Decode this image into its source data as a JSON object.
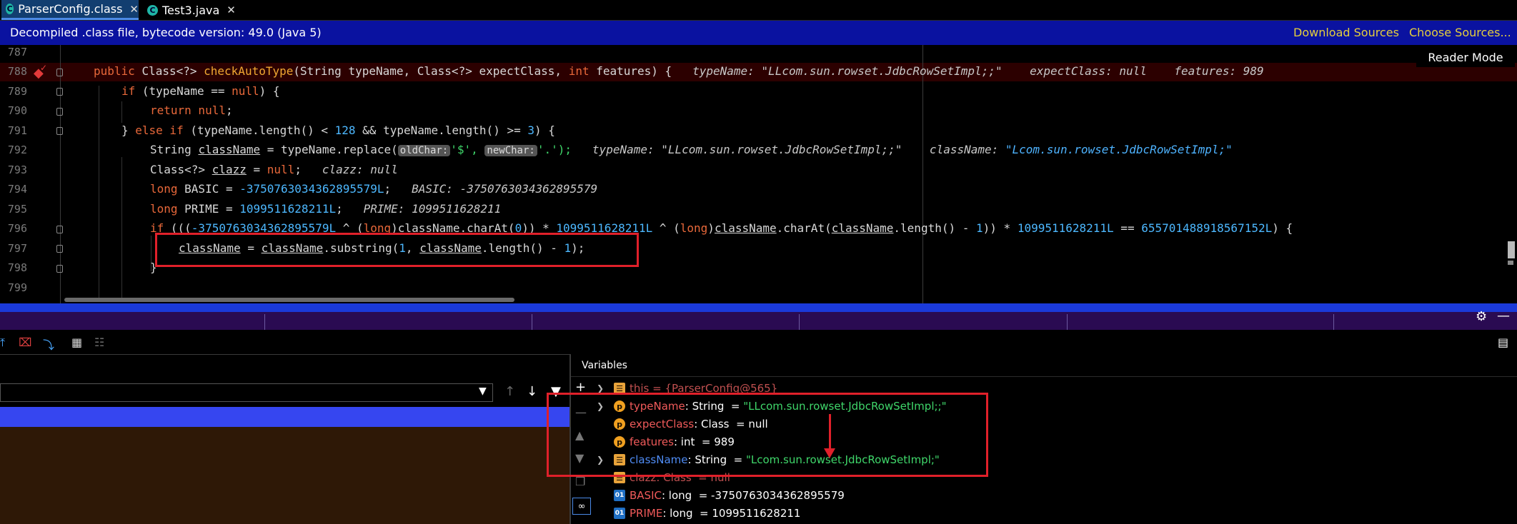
{
  "tabs": [
    {
      "label": "ParserConfig.class",
      "icon": "class-file-icon",
      "active": true
    },
    {
      "label": "Test3.java",
      "icon": "java-file-icon",
      "active": false
    }
  ],
  "banner": {
    "text": "Decompiled .class file, bytecode version: 49.0 (Java 5)",
    "download_sources": "Download Sources",
    "choose_sources": "Choose Sources..."
  },
  "editor": {
    "reader_mode": "Reader Mode",
    "line_numbers": [
      "787",
      "788",
      "789",
      "790",
      "791",
      "792",
      "793",
      "794",
      "795",
      "796",
      "797",
      "798",
      "799"
    ],
    "code": {
      "l788_public": "public",
      "l788_type": "Class<?>",
      "l788_method": "checkAutoType",
      "l788_open": "(String typeName, Class<?> expectClass, ",
      "l788_int": "int",
      "l788_rest": " features) {",
      "l788_hint": "typeName: \"LLcom.sun.rowset.JdbcRowSetImpl;;\"    expectClass: null    features: 989",
      "l789_if": "if",
      "l789_rest": " (typeName == ",
      "l789_null": "null",
      "l789_end": ") {",
      "l790_return": "return",
      "l790_null": " null",
      "l790_end": ";",
      "l791_a": "} ",
      "l791_else": "else if",
      "l791_b": " (typeName.length() < ",
      "l791_n1": "128",
      "l791_c": " && typeName.length() >= ",
      "l791_n2": "3",
      "l791_d": ") {",
      "l792_a": "String ",
      "l792_var": "className",
      "l792_b": " = typeName.replace(",
      "l792_chip1": "oldChar:",
      "l792_c": "'$', ",
      "l792_chip2": "newChar:",
      "l792_d": "'.');",
      "l792_hint": "typeName: \"LLcom.sun.rowset.JdbcRowSetImpl;;\"    className: ",
      "l792_hint_val": "\"Lcom.sun.rowset.JdbcRowSetImpl;\"",
      "l793_a": "Class<?> ",
      "l793_var": "clazz",
      "l793_b": " = ",
      "l793_null": "null",
      "l793_c": ";",
      "l793_hint": "clazz: null",
      "l794_long": "long",
      "l794_a": " BASIC = ",
      "l794_num": "-3750763034362895579L",
      "l794_b": ";",
      "l794_hint": "BASIC: -3750763034362895579",
      "l795_long": "long",
      "l795_a": " PRIME = ",
      "l795_num": "1099511628211L",
      "l795_b": ";",
      "l795_hint": "PRIME: 1099511628211",
      "l796_if": "if",
      "l796_a": " (((",
      "l796_n1": "-3750763034362895579L",
      "l796_b": " ^ (",
      "l796_long1": "long",
      "l796_c": ")",
      "l796_var1": "className",
      "l796_d": ".charAt(",
      "l796_n2": "0",
      "l796_e": ")) * ",
      "l796_n3": "1099511628211L",
      "l796_f": " ^ (",
      "l796_long2": "long",
      "l796_g": ")",
      "l796_var2": "className",
      "l796_h": ".charAt(",
      "l796_var3": "className",
      "l796_i": ".length() - ",
      "l796_n4": "1",
      "l796_j": ")) * ",
      "l796_n5": "1099511628211L",
      "l796_k": " == ",
      "l796_n6": "655701488918567152L",
      "l796_l": ") {",
      "l797_var1": "className",
      "l797_a": " = ",
      "l797_var2": "className",
      "l797_b": ".substring(",
      "l797_n1": "1",
      "l797_c": ", ",
      "l797_var3": "className",
      "l797_d": ".length() - ",
      "l797_n2": "1",
      "l797_e": ");",
      "l798": "}"
    }
  },
  "debug": {
    "variables_header": "Variables",
    "variables": [
      {
        "name": "this",
        "sep": " = ",
        "value": "{ParserConfig@565}",
        "icon": "field-icon",
        "expandable": true,
        "muted": true
      },
      {
        "name": "typeName",
        "sep": ": String  = ",
        "value": "\"LLcom.sun.rowset.JdbcRowSetImpl;;\"",
        "icon": "param-icon",
        "expandable": true
      },
      {
        "name": "expectClass",
        "sep": ": Class  = null",
        "value": "",
        "icon": "param-icon",
        "expandable": false
      },
      {
        "name": "features",
        "sep": ": int  = 989",
        "value": "",
        "icon": "param-icon",
        "expandable": false
      },
      {
        "name": "className",
        "sep": ": String  = ",
        "value": "\"Lcom.sun.rowset.JdbcRowSetImpl;\"",
        "icon": "field-icon",
        "expandable": true
      },
      {
        "name": "clazz",
        "sep": ": Class  = null",
        "value": "",
        "icon": "field-icon",
        "expandable": false,
        "muted": true
      },
      {
        "name": "BASIC",
        "sep": ": long  = -3750763034362895579",
        "value": "",
        "icon": "local-icon",
        "expandable": false
      },
      {
        "name": "PRIME",
        "sep": ": long  = 1099511628211",
        "value": "",
        "icon": "local-icon",
        "expandable": false
      }
    ]
  },
  "colors": {
    "banner_bg": "#0a12a0",
    "debug_band": "#2a0b52",
    "selected_frame": "#3646f0",
    "highlight_box": "#e0202a"
  }
}
